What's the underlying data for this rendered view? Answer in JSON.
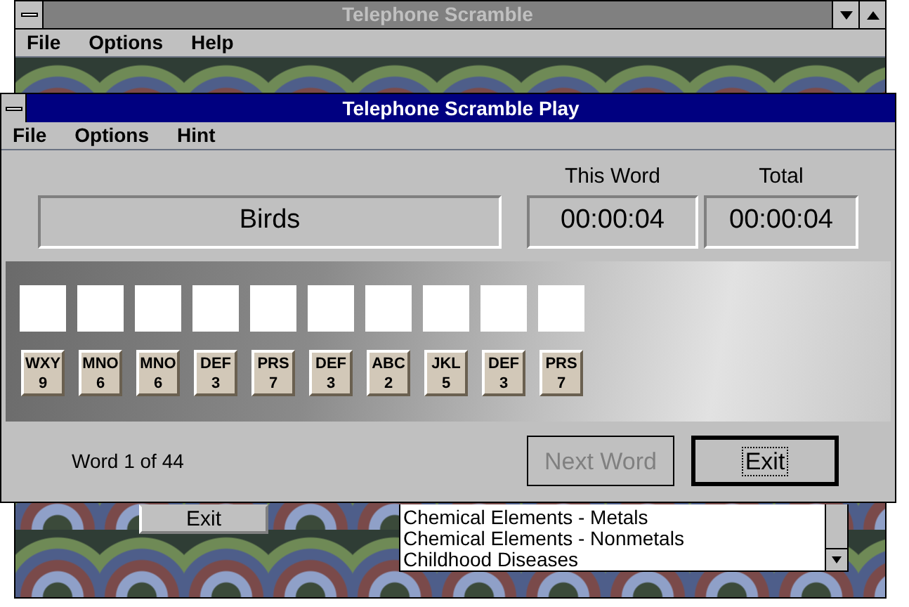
{
  "main_window": {
    "title": "Telephone Scramble",
    "menu": [
      "File",
      "Options",
      "Help"
    ],
    "exit_button": "Exit",
    "list": [
      "Chemical Elements - Metals",
      "Chemical Elements - Nonmetals",
      "Childhood Diseases"
    ]
  },
  "play_window": {
    "title": "Telephone Scramble Play",
    "menu": [
      "File",
      "Options",
      "Hint"
    ],
    "category": "Birds",
    "this_word_label": "This Word",
    "this_word_time": "00:00:04",
    "total_label": "Total",
    "total_time": "00:00:04",
    "keys": [
      {
        "letters": "WXY",
        "digit": "9"
      },
      {
        "letters": "MNO",
        "digit": "6"
      },
      {
        "letters": "MNO",
        "digit": "6"
      },
      {
        "letters": "DEF",
        "digit": "3"
      },
      {
        "letters": "PRS",
        "digit": "7"
      },
      {
        "letters": "DEF",
        "digit": "3"
      },
      {
        "letters": "ABC",
        "digit": "2"
      },
      {
        "letters": "JKL",
        "digit": "5"
      },
      {
        "letters": "DEF",
        "digit": "3"
      },
      {
        "letters": "PRS",
        "digit": "7"
      }
    ],
    "word_counter": "Word 1 of 44",
    "buttons": [
      {
        "label": "Next Word",
        "disabled": true,
        "focused": false
      },
      {
        "label": "Exit",
        "disabled": false,
        "focused": true
      }
    ]
  }
}
